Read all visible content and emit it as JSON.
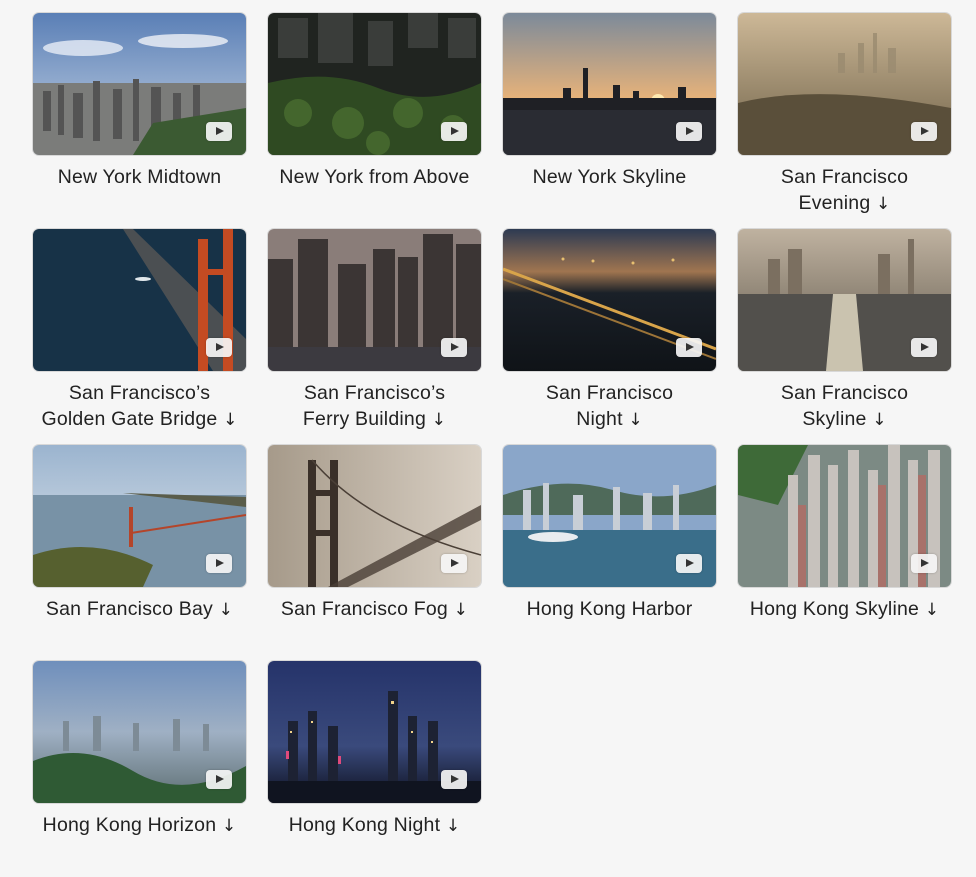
{
  "screensavers": [
    {
      "line1": "New York Midtown",
      "line2": "",
      "download": false
    },
    {
      "line1": "New York from Above",
      "line2": "",
      "download": false
    },
    {
      "line1": "New York Skyline",
      "line2": "",
      "download": false
    },
    {
      "line1": "San Francisco",
      "line2": "Evening",
      "download": true
    },
    {
      "line1": "San Francisco’s",
      "line2": "Golden Gate Bridge",
      "download": true
    },
    {
      "line1": "San Francisco’s",
      "line2": "Ferry Building",
      "download": true
    },
    {
      "line1": "San Francisco",
      "line2": "Night",
      "download": true
    },
    {
      "line1": "San Francisco",
      "line2": "Skyline",
      "download": true
    },
    {
      "line1": "San Francisco Bay",
      "line2": "",
      "download": true
    },
    {
      "line1": "San Francisco Fog",
      "line2": "",
      "download": true
    },
    {
      "line1": "Hong Kong Harbor",
      "line2": "",
      "download": false
    },
    {
      "line1": "Hong Kong Skyline",
      "line2": "",
      "download": true
    },
    {
      "line1": "Hong Kong Horizon",
      "line2": "",
      "download": true
    },
    {
      "line1": "Hong Kong Night",
      "line2": "",
      "download": true
    }
  ],
  "download_glyph": "↓",
  "icons": {
    "play": "play-icon",
    "download": "download-arrow-icon"
  }
}
